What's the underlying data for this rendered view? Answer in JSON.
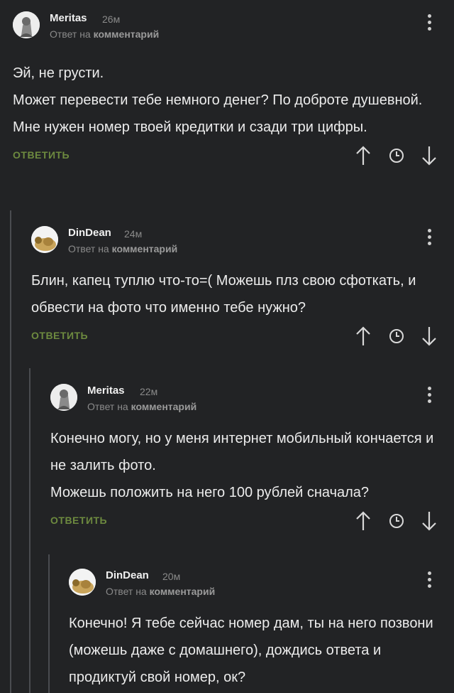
{
  "reply_prefix": "Ответ на",
  "reply_target": "комментарий",
  "reply_label": "ОТВЕТИТЬ",
  "icons": {
    "upvote": "arrow-up-icon",
    "history": "clock-icon",
    "downvote": "arrow-down-icon",
    "menu": "kebab-menu-icon"
  },
  "colors": {
    "background": "#222325",
    "reply_action": "#6d8a3f",
    "thread_line": "#4a4c50"
  },
  "comments": [
    {
      "author": "Meritas",
      "time": "26м",
      "text": "Эй, не грусти.\nМожет перевести тебе немного денег? По доброте душевной.\nМне нужен номер твоей кредитки и сзади три цифры."
    },
    {
      "author": "DinDean",
      "time": "24м",
      "text": "Блин, капец туплю что-то=( Можешь плз свою сфоткать, и обвести на фото что именно тебе нужно?"
    },
    {
      "author": "Meritas",
      "time": "22м",
      "text": "Конечно могу, но у меня интернет мобильный кончается и не залить фото.\nМожешь положить на него 100 рублей сначала?"
    },
    {
      "author": "DinDean",
      "time": "20м",
      "text": "Конечно! Я тебе сейчас номер дам, ты на него позвони (можешь даже с домашнего), дождись ответа и продиктуй свой номер, ок?"
    }
  ]
}
